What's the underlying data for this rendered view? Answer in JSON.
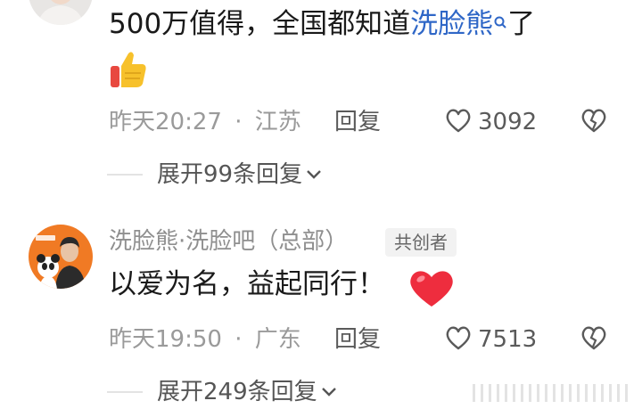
{
  "comments": [
    {
      "text_prefix": "500万值得，全国都知道",
      "link_text": "洗脸熊",
      "text_suffix": "了",
      "time": "昨天20:27",
      "separator": "·",
      "location": "江苏",
      "reply_label": "回复",
      "likes": "3092",
      "expand_label": "展开99条回复"
    },
    {
      "author": "洗脸熊·洗脸吧（总部）",
      "badge": "共创者",
      "text": "以爱为名，益起同行！",
      "time": "昨天19:50",
      "separator": "·",
      "location": "广东",
      "reply_label": "回复",
      "likes": "7513",
      "expand_label": "展开249条回复"
    }
  ],
  "icons": {
    "like": "heart-outline-icon",
    "dislike": "broken-heart-icon",
    "thumbs_up": "thumbs-up-emoji",
    "heart": "red-heart-emoji",
    "search": "search-icon",
    "chevron": "chevron-down-icon"
  },
  "colors": {
    "link": "#2f67c7",
    "meta": "#9a9a9a",
    "badge_bg": "#f2f2f2"
  }
}
